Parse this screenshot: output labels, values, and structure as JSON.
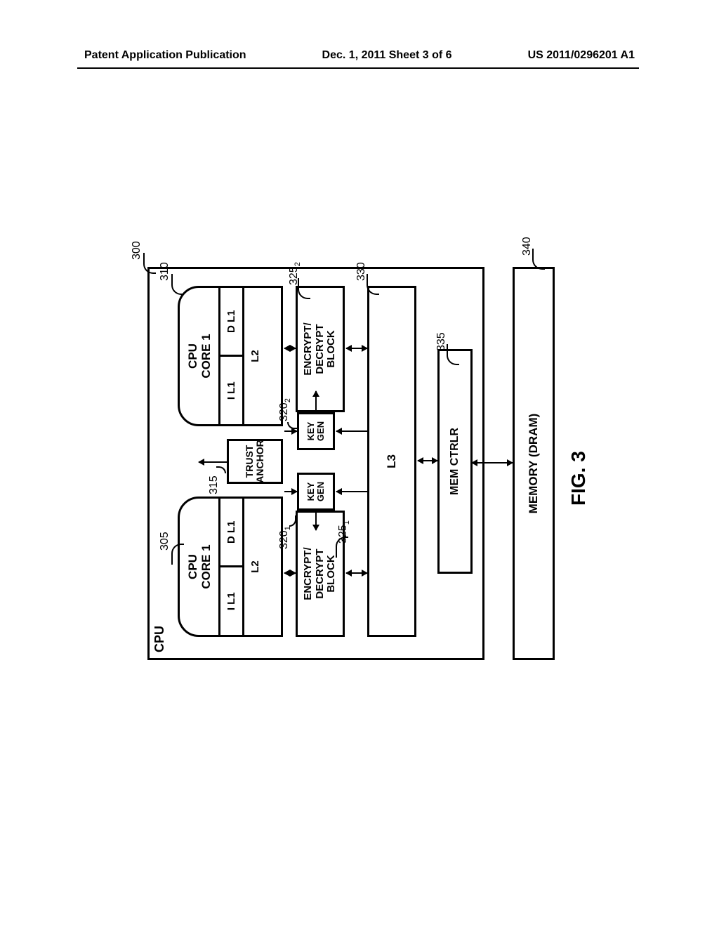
{
  "header": {
    "left": "Patent Application Publication",
    "mid": "Dec. 1, 2011  Sheet 3 of 6",
    "right": "US 2011/0296201 A1"
  },
  "figure": {
    "cpu_label": "CPU",
    "core1": {
      "title": "CPU\nCORE 1",
      "il1": "I L1",
      "dl1": "D L1",
      "l2": "L2"
    },
    "core2": {
      "title": "CPU\nCORE 1",
      "il1": "I L1",
      "dl1": "D L1",
      "l2": "L2"
    },
    "trust": "TRUST\nANCHOR",
    "keygen1": "KEY\nGEN",
    "keygen2": "KEY\nGEN",
    "enc1": "ENCRYPT/\nDECRYPT\nBLOCK",
    "enc2": "ENCRYPT/\nDECRYPT\nBLOCK",
    "l3": "L3",
    "memctrl": "MEM CTRLR",
    "dram": "MEMORY (DRAM)",
    "caption": "FIG. 3"
  },
  "refs": {
    "cpu300": "300",
    "core305": "305",
    "core310": "310",
    "trust315": "315",
    "kg320_1": "320",
    "kg320_2": "320",
    "enc325_1": "325",
    "enc325_2": "325",
    "l3_330": "330",
    "mc335": "335",
    "dram340": "340"
  }
}
